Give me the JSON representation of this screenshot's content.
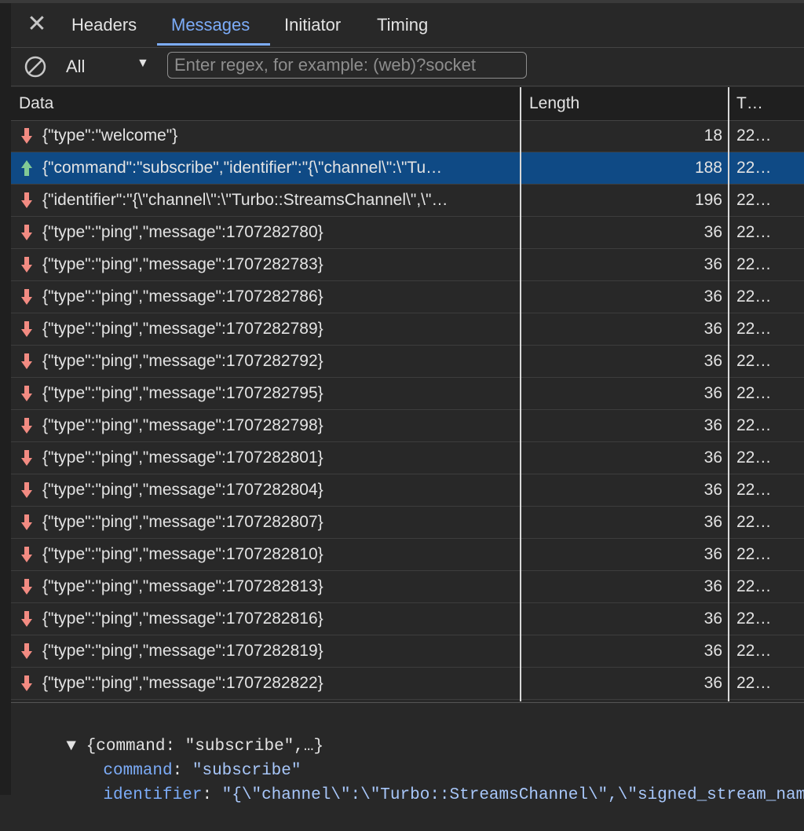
{
  "tabs": {
    "close": "✕",
    "headers": "Headers",
    "messages": "Messages",
    "initiator": "Initiator",
    "timing": "Timing"
  },
  "toolbar": {
    "filter_type": "All",
    "filter_placeholder": "Enter regex, for example: (web)?socket"
  },
  "table": {
    "columns": [
      "Data",
      "Length",
      "T…"
    ],
    "rows": [
      {
        "dir": "down",
        "data": "{\"type\":\"welcome\"}",
        "length": "18",
        "time": "22…"
      },
      {
        "dir": "up",
        "data": "{\"command\":\"subscribe\",\"identifier\":\"{\\\"channel\\\":\\\"Tu…",
        "length": "188",
        "time": "22…",
        "selected": true
      },
      {
        "dir": "down",
        "data": "{\"identifier\":\"{\\\"channel\\\":\\\"Turbo::StreamsChannel\\\",\\\"…",
        "length": "196",
        "time": "22…"
      },
      {
        "dir": "down",
        "data": "{\"type\":\"ping\",\"message\":1707282780}",
        "length": "36",
        "time": "22…"
      },
      {
        "dir": "down",
        "data": "{\"type\":\"ping\",\"message\":1707282783}",
        "length": "36",
        "time": "22…"
      },
      {
        "dir": "down",
        "data": "{\"type\":\"ping\",\"message\":1707282786}",
        "length": "36",
        "time": "22…"
      },
      {
        "dir": "down",
        "data": "{\"type\":\"ping\",\"message\":1707282789}",
        "length": "36",
        "time": "22…"
      },
      {
        "dir": "down",
        "data": "{\"type\":\"ping\",\"message\":1707282792}",
        "length": "36",
        "time": "22…"
      },
      {
        "dir": "down",
        "data": "{\"type\":\"ping\",\"message\":1707282795}",
        "length": "36",
        "time": "22…"
      },
      {
        "dir": "down",
        "data": "{\"type\":\"ping\",\"message\":1707282798}",
        "length": "36",
        "time": "22…"
      },
      {
        "dir": "down",
        "data": "{\"type\":\"ping\",\"message\":1707282801}",
        "length": "36",
        "time": "22…"
      },
      {
        "dir": "down",
        "data": "{\"type\":\"ping\",\"message\":1707282804}",
        "length": "36",
        "time": "22…"
      },
      {
        "dir": "down",
        "data": "{\"type\":\"ping\",\"message\":1707282807}",
        "length": "36",
        "time": "22…"
      },
      {
        "dir": "down",
        "data": "{\"type\":\"ping\",\"message\":1707282810}",
        "length": "36",
        "time": "22…"
      },
      {
        "dir": "down",
        "data": "{\"type\":\"ping\",\"message\":1707282813}",
        "length": "36",
        "time": "22…"
      },
      {
        "dir": "down",
        "data": "{\"type\":\"ping\",\"message\":1707282816}",
        "length": "36",
        "time": "22…"
      },
      {
        "dir": "down",
        "data": "{\"type\":\"ping\",\"message\":1707282819}",
        "length": "36",
        "time": "22…"
      },
      {
        "dir": "down",
        "data": "{\"type\":\"ping\",\"message\":1707282822}",
        "length": "36",
        "time": "22…"
      }
    ]
  },
  "detail": {
    "summary": "{command: \"subscribe\",…}",
    "fields": [
      {
        "key": "command",
        "value": "\"subscribe\""
      },
      {
        "key": "identifier",
        "value": "\"{\\\"channel\\\":\\\"Turbo::StreamsChannel\\\",\\\"signed_stream_name\\"
      }
    ]
  },
  "colors": {
    "accent": "#7cacf8",
    "selected_row": "#0f4a85",
    "incoming_arrow": "#f28b82",
    "outgoing_arrow": "#81c995"
  },
  "icons": {
    "close": "close-icon",
    "clear": "block-icon",
    "dropdown": "chevron-down-icon",
    "received": "arrow-down-icon",
    "sent": "arrow-up-icon",
    "expand": "triangle-down-icon"
  }
}
